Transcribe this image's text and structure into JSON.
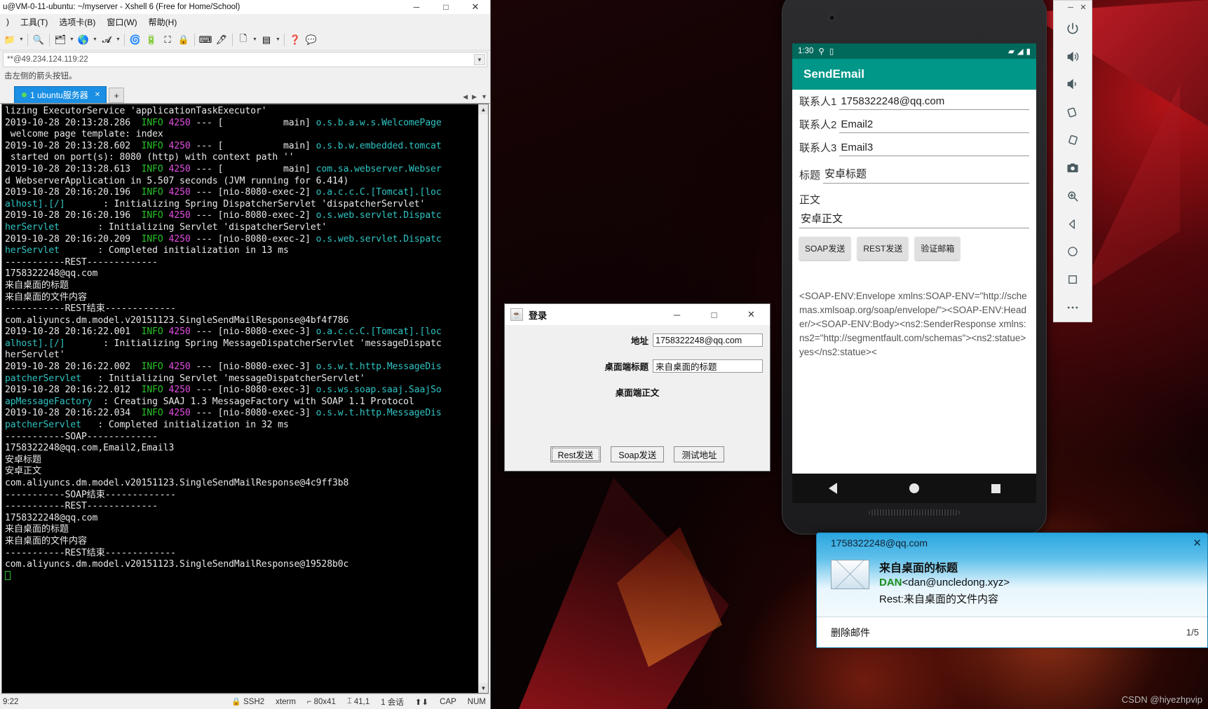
{
  "xshell": {
    "title": "u@VM-0-11-ubuntu: ~/myserver - Xshell 6 (Free for Home/School)",
    "window_buttons": {
      "minimize": "─",
      "maximize": "□",
      "close": "✕"
    },
    "menus": [
      "工具(T)",
      "选项卡(B)",
      "窗口(W)",
      "帮助(H)"
    ],
    "toolbar_icons": [
      "folder-icon",
      "search-icon",
      "transfer-icon",
      "globe-icon",
      "font-icon",
      "ssh-icon",
      "tunnel-icon",
      "fullscreen-icon",
      "lock-icon",
      "keyboard-icon",
      "highlight-icon",
      "newfile-icon",
      "layout-icon",
      "help-icon",
      "comment-icon"
    ],
    "address": "**@49.234.124.119:22",
    "hint": "击左侧的箭头按钮。",
    "tab": {
      "label": "1 ubuntu服务器",
      "close": "✕"
    },
    "new_tab": "+",
    "status": {
      "time": "9:22",
      "protocol": "SSH2",
      "term_type": "xterm",
      "size": "80x41",
      "cursor": "41,1",
      "sessions": "1 会话",
      "cap": "CAP",
      "num": "NUM"
    },
    "terminal_lines": [
      [
        {
          "t": "lizing ExecutorService 'applicationTaskExecutor'",
          "c": "w"
        }
      ],
      [
        {
          "t": "2019-10-28 20:13:28.286  ",
          "c": "w"
        },
        {
          "t": "INFO",
          "c": "g"
        },
        {
          "t": " ",
          "c": "w"
        },
        {
          "t": "4250",
          "c": "m"
        },
        {
          "t": " --- [           main] ",
          "c": "w"
        },
        {
          "t": "o.s.b.a.w.s.WelcomePage",
          "c": "c"
        }
      ],
      [
        {
          "t": " welcome page template: index",
          "c": "w"
        }
      ],
      [
        {
          "t": "2019-10-28 20:13:28.602  ",
          "c": "w"
        },
        {
          "t": "INFO",
          "c": "g"
        },
        {
          "t": " ",
          "c": "w"
        },
        {
          "t": "4250",
          "c": "m"
        },
        {
          "t": " --- [           main] ",
          "c": "w"
        },
        {
          "t": "o.s.b.w.embedded.tomcat",
          "c": "c"
        }
      ],
      [
        {
          "t": " started on port(s): 8080 (http) with context path ''",
          "c": "w"
        }
      ],
      [
        {
          "t": "2019-10-28 20:13:28.613  ",
          "c": "w"
        },
        {
          "t": "INFO",
          "c": "g"
        },
        {
          "t": " ",
          "c": "w"
        },
        {
          "t": "4250",
          "c": "m"
        },
        {
          "t": " --- [           main] ",
          "c": "w"
        },
        {
          "t": "com.sa.webserver.Webser",
          "c": "c"
        }
      ],
      [
        {
          "t": "d WebserverApplication in 5.507 seconds (JVM running for 6.414)",
          "c": "w"
        }
      ],
      [
        {
          "t": "2019-10-28 20:16:20.196  ",
          "c": "w"
        },
        {
          "t": "INFO",
          "c": "g"
        },
        {
          "t": " ",
          "c": "w"
        },
        {
          "t": "4250",
          "c": "m"
        },
        {
          "t": " --- [nio-8080-exec-2] ",
          "c": "w"
        },
        {
          "t": "o.a.c.c.C.[Tomcat].[loc",
          "c": "c"
        }
      ],
      [
        {
          "t": "alhost].[/]",
          "c": "c"
        },
        {
          "t": "       : Initializing Spring DispatcherServlet 'dispatcherServlet'",
          "c": "w"
        }
      ],
      [
        {
          "t": "2019-10-28 20:16:20.196  ",
          "c": "w"
        },
        {
          "t": "INFO",
          "c": "g"
        },
        {
          "t": " ",
          "c": "w"
        },
        {
          "t": "4250",
          "c": "m"
        },
        {
          "t": " --- [nio-8080-exec-2] ",
          "c": "w"
        },
        {
          "t": "o.s.web.servlet.Dispatc",
          "c": "c"
        }
      ],
      [
        {
          "t": "herServlet",
          "c": "c"
        },
        {
          "t": "       : Initializing Servlet 'dispatcherServlet'",
          "c": "w"
        }
      ],
      [
        {
          "t": "2019-10-28 20:16:20.209  ",
          "c": "w"
        },
        {
          "t": "INFO",
          "c": "g"
        },
        {
          "t": " ",
          "c": "w"
        },
        {
          "t": "4250",
          "c": "m"
        },
        {
          "t": " --- [nio-8080-exec-2] ",
          "c": "w"
        },
        {
          "t": "o.s.web.servlet.Dispatc",
          "c": "c"
        }
      ],
      [
        {
          "t": "herServlet",
          "c": "c"
        },
        {
          "t": "       : Completed initialization in 13 ms",
          "c": "w"
        }
      ],
      [
        {
          "t": "-----------REST-------------",
          "c": "w"
        }
      ],
      [
        {
          "t": "1758322248@qq.com",
          "c": "w"
        }
      ],
      [
        {
          "t": "来自桌面的标题",
          "c": "w"
        }
      ],
      [
        {
          "t": "来自桌面的文件内容",
          "c": "w"
        }
      ],
      [
        {
          "t": "-----------REST结束-------------",
          "c": "w"
        }
      ],
      [
        {
          "t": "com.aliyuncs.dm.model.v20151123.SingleSendMailResponse@4bf4f786",
          "c": "w"
        }
      ],
      [
        {
          "t": "2019-10-28 20:16:22.001  ",
          "c": "w"
        },
        {
          "t": "INFO",
          "c": "g"
        },
        {
          "t": " ",
          "c": "w"
        },
        {
          "t": "4250",
          "c": "m"
        },
        {
          "t": " --- [nio-8080-exec-3] ",
          "c": "w"
        },
        {
          "t": "o.a.c.c.C.[Tomcat].[loc",
          "c": "c"
        }
      ],
      [
        {
          "t": "alhost].[/]",
          "c": "c"
        },
        {
          "t": "       : Initializing Spring MessageDispatcherServlet 'messageDispatc",
          "c": "w"
        }
      ],
      [
        {
          "t": "herServlet'",
          "c": "w"
        }
      ],
      [
        {
          "t": "2019-10-28 20:16:22.002  ",
          "c": "w"
        },
        {
          "t": "INFO",
          "c": "g"
        },
        {
          "t": " ",
          "c": "w"
        },
        {
          "t": "4250",
          "c": "m"
        },
        {
          "t": " --- [nio-8080-exec-3] ",
          "c": "w"
        },
        {
          "t": "o.s.w.t.http.MessageDis",
          "c": "c"
        }
      ],
      [
        {
          "t": "patcherServlet",
          "c": "c"
        },
        {
          "t": "   : Initializing Servlet 'messageDispatcherServlet'",
          "c": "w"
        }
      ],
      [
        {
          "t": "2019-10-28 20:16:22.012  ",
          "c": "w"
        },
        {
          "t": "INFO",
          "c": "g"
        },
        {
          "t": " ",
          "c": "w"
        },
        {
          "t": "4250",
          "c": "m"
        },
        {
          "t": " --- [nio-8080-exec-3] ",
          "c": "w"
        },
        {
          "t": "o.s.ws.soap.saaj.SaajSo",
          "c": "c"
        }
      ],
      [
        {
          "t": "apMessageFactory",
          "c": "c"
        },
        {
          "t": "  : Creating SAAJ 1.3 MessageFactory with SOAP 1.1 Protocol",
          "c": "w"
        }
      ],
      [
        {
          "t": "2019-10-28 20:16:22.034  ",
          "c": "w"
        },
        {
          "t": "INFO",
          "c": "g"
        },
        {
          "t": " ",
          "c": "w"
        },
        {
          "t": "4250",
          "c": "m"
        },
        {
          "t": " --- [nio-8080-exec-3] ",
          "c": "w"
        },
        {
          "t": "o.s.w.t.http.MessageDis",
          "c": "c"
        }
      ],
      [
        {
          "t": "patcherServlet",
          "c": "c"
        },
        {
          "t": "   : Completed initialization in 32 ms",
          "c": "w"
        }
      ],
      [
        {
          "t": "-----------SOAP-------------",
          "c": "w"
        }
      ],
      [
        {
          "t": "1758322248@qq.com,Email2,Email3",
          "c": "w"
        }
      ],
      [
        {
          "t": "安卓标题",
          "c": "w"
        }
      ],
      [
        {
          "t": "安卓正文",
          "c": "w"
        }
      ],
      [
        {
          "t": "com.aliyuncs.dm.model.v20151123.SingleSendMailResponse@4c9ff3b8",
          "c": "w"
        }
      ],
      [
        {
          "t": "-----------SOAP结束-------------",
          "c": "w"
        }
      ],
      [
        {
          "t": "-----------REST-------------",
          "c": "w"
        }
      ],
      [
        {
          "t": "1758322248@qq.com",
          "c": "w"
        }
      ],
      [
        {
          "t": "来自桌面的标题",
          "c": "w"
        }
      ],
      [
        {
          "t": "来自桌面的文件内容",
          "c": "w"
        }
      ],
      [
        {
          "t": "-----------REST结束-------------",
          "c": "w"
        }
      ],
      [
        {
          "t": "com.aliyuncs.dm.model.v20151123.SingleSendMailResponse@19528b0c",
          "c": "w"
        }
      ]
    ]
  },
  "login_dialog": {
    "title": "登录",
    "icon": "java-coffee-icon",
    "window_buttons": {
      "minimize": "─",
      "maximize": "□",
      "close": "✕"
    },
    "address_label": "地址",
    "address_value": "1758322248@qq.com",
    "subject_label": "桌面端标题",
    "subject_value": "来自桌面的标题",
    "body_label": "桌面端正文",
    "buttons": [
      "Rest发送",
      "Soap发送",
      "测试地址"
    ]
  },
  "emulator": {
    "status": {
      "time": "1:30",
      "location_icon": "location-icon",
      "sd_icon": "sdcard-icon",
      "wifi_icon": "wifi-off-icon",
      "signal_icon": "signal-icon",
      "battery_icon": "battery-icon"
    },
    "app_title": "SendEmail",
    "fields": [
      {
        "label": "联系人1",
        "value": "1758322248@qq.com"
      },
      {
        "label": "联系人2",
        "value": "Email2"
      },
      {
        "label": "联系人3",
        "value": "Email3"
      },
      {
        "label": "标题",
        "value": "安卓标题"
      }
    ],
    "body_label": "正文",
    "body_value": "安卓正文",
    "buttons": [
      "SOAP发送",
      "REST发送",
      "验证邮箱"
    ],
    "xml_output": "<SOAP-ENV:Envelope xmlns:SOAP-ENV=\"http://schemas.xmlsoap.org/soap/envelope/\"><SOAP-ENV:Header/><SOAP-ENV:Body><ns2:SenderResponse xmlns:ns2=\"http://segmentfault.com/schemas\"><ns2:statue>yes</ns2:statue><",
    "navbar": {
      "back": "back-icon",
      "home": "home-icon",
      "recents": "recents-icon"
    },
    "toolbar_icons": [
      "power-icon",
      "volume-up-icon",
      "volume-down-icon",
      "rotate-left-icon",
      "rotate-right-icon",
      "screenshot-icon",
      "zoom-icon",
      "back-icon",
      "home-icon",
      "overview-icon",
      "more-icon"
    ],
    "toolbar_window_buttons": {
      "minimize": "─",
      "close": "✕"
    }
  },
  "toast": {
    "account": "1758322248@qq.com",
    "close": "✕",
    "icon": "mail-icon",
    "subject": "来自桌面的标题",
    "sender_name": "DAN",
    "sender_addr": "<dan@uncledong.xyz>",
    "preview": "Rest:来自桌面的文件内容",
    "delete_label": "删除邮件",
    "pager": "1/5"
  },
  "watermark": "CSDN @hiyezhpvip"
}
